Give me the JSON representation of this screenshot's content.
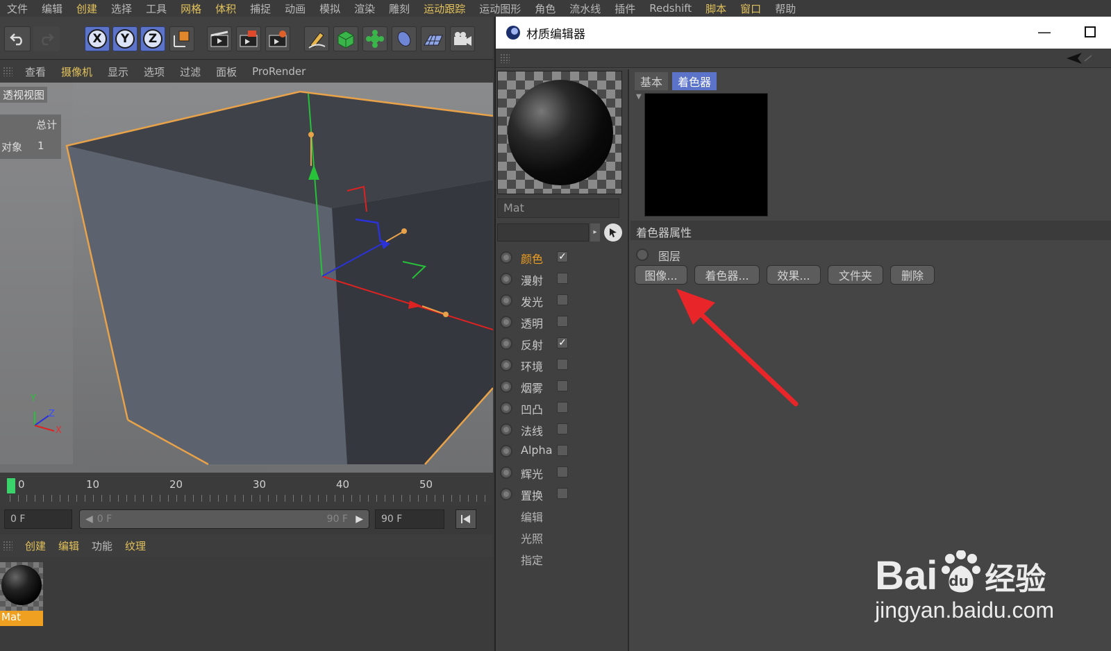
{
  "menubar": {
    "items": [
      "文件",
      "编辑",
      "创建",
      "选择",
      "工具",
      "网格",
      "体积",
      "捕捉",
      "动画",
      "模拟",
      "渲染",
      "雕刻",
      "运动跟踪",
      "运动图形",
      "角色",
      "流水线",
      "插件",
      "Redshift",
      "脚本",
      "窗口",
      "帮助"
    ]
  },
  "toolbar": {
    "x": "X",
    "y": "Y",
    "z": "Z"
  },
  "viewport_menu": {
    "items": [
      "查看",
      "摄像机",
      "显示",
      "选项",
      "过滤",
      "面板",
      "ProRender"
    ]
  },
  "viewport": {
    "title": "透视视图",
    "hud_header": "总计",
    "hud_label": "对象",
    "hud_value": "1",
    "axis_y": "Y",
    "axis_z": "Z",
    "axis_x": "X"
  },
  "timeline": {
    "ticks": [
      "0",
      "10",
      "20",
      "30",
      "40",
      "50"
    ],
    "start_field": "0 F",
    "range_start": "0 F",
    "range_end": "90 F",
    "end_field": "90 F"
  },
  "material_manager": {
    "menu": [
      "创建",
      "编辑",
      "功能",
      "纹理"
    ],
    "material_name": "Mat"
  },
  "editor": {
    "title": "材质编辑器",
    "material_name": "Mat",
    "tabs": [
      "基本",
      "着色器"
    ],
    "section_title": "着色器属性",
    "layer_label": "图层",
    "buttons": [
      "图像...",
      "着色器...",
      "效果...",
      "文件夹",
      "删除"
    ],
    "channels": [
      {
        "label": "颜色",
        "checked": true
      },
      {
        "label": "漫射",
        "checked": false
      },
      {
        "label": "发光",
        "checked": false
      },
      {
        "label": "透明",
        "checked": false
      },
      {
        "label": "反射",
        "checked": true
      },
      {
        "label": "环境",
        "checked": false
      },
      {
        "label": "烟雾",
        "checked": false
      },
      {
        "label": "凹凸",
        "checked": false
      },
      {
        "label": "法线",
        "checked": false
      },
      {
        "label": "Alpha",
        "checked": false
      },
      {
        "label": "辉光",
        "checked": false
      },
      {
        "label": "置换",
        "checked": false
      }
    ],
    "sub_items": [
      "编辑",
      "光照",
      "指定"
    ]
  },
  "watermark": {
    "brand": "Bai",
    "brand_suffix": "du",
    "cn": "经验",
    "url": "jingyan.baidu.com"
  },
  "colors": {
    "accent": "#e2c25c",
    "active_channel": "#f0a020",
    "tab_active": "#5b74c9",
    "arrow": "#e8262a",
    "selection_edge": "#e8a24a"
  }
}
